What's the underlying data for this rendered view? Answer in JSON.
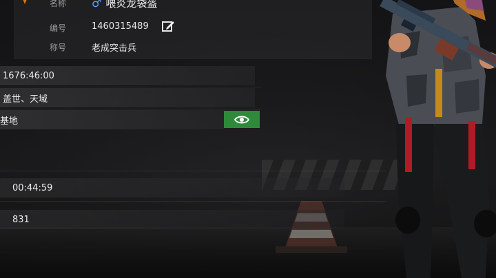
{
  "profile": {
    "name_label": "名称",
    "name_value": "喂炎龙袋盔",
    "gender_icon": "male-symbol",
    "id_label": "编号",
    "id_value": "1460315489",
    "title_label": "称号",
    "title_value": "老成突击兵"
  },
  "stats": {
    "playtime": "1676:46:00",
    "region": "盖世、天域",
    "base": "基地",
    "duration": "00:44:59",
    "count": "831"
  },
  "colors": {
    "accent_green": "#2e8a3a",
    "gender_blue": "#5aa8ff"
  },
  "icons": {
    "edit": "edit-icon",
    "view": "eye-icon",
    "emblem": "rank-emblem-icon"
  }
}
